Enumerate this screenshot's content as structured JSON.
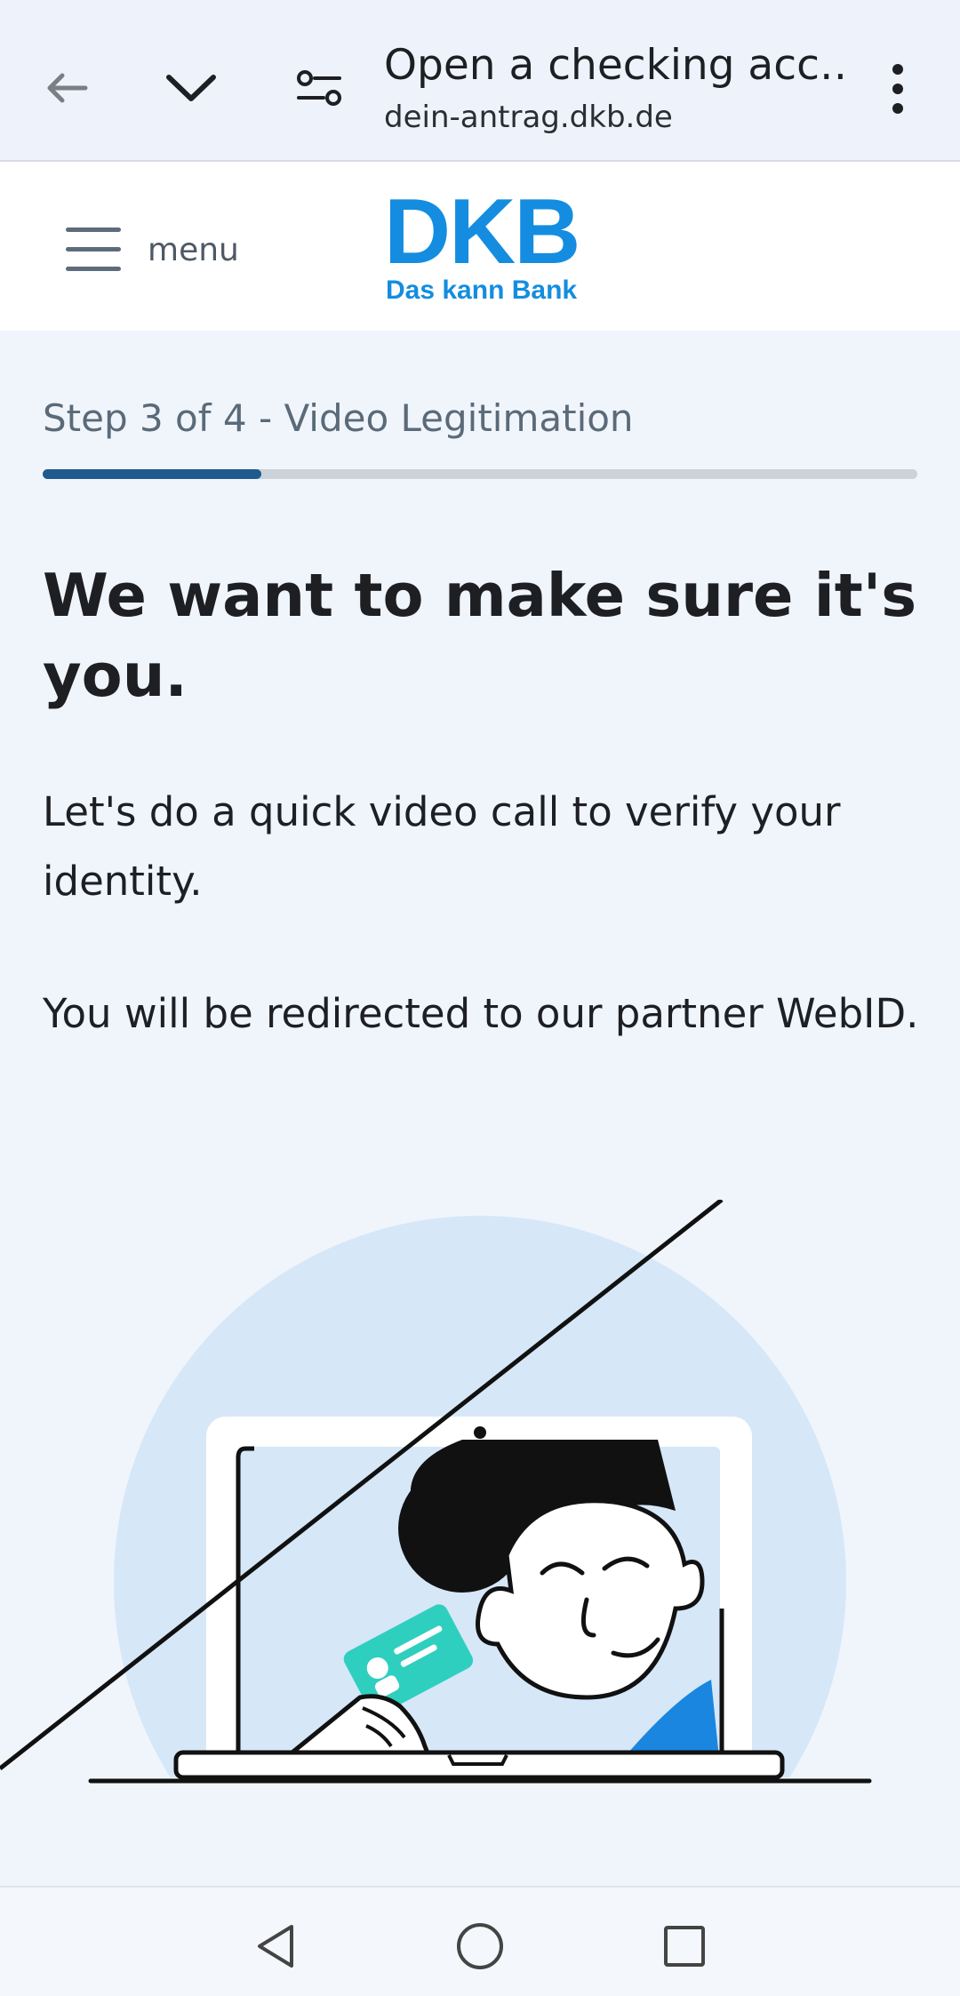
{
  "browser": {
    "title": "Open a checking acc…",
    "url": "dein-antrag.dkb.de"
  },
  "header": {
    "menu_label": "menu",
    "logo_main": "DKB",
    "logo_sub": "Das kann Bank",
    "brand_color": "#148de0"
  },
  "content": {
    "step_label": "Step 3 of 4 - Video Legitimation",
    "progress": 0.25,
    "headline": "We want to make sure it's you.",
    "paragraph1": "Let's do a quick video call to verify your identity.",
    "paragraph2": "You will be redirected to our partner WebID."
  },
  "icons": {
    "back": "back-arrow-icon",
    "collapse": "chevron-down-icon",
    "site_settings": "tune-icon",
    "more": "more-vert-icon",
    "menu": "hamburger-icon",
    "nav_back": "triangle-back-icon",
    "nav_home": "circle-home-icon",
    "nav_recent": "square-recent-icon"
  }
}
